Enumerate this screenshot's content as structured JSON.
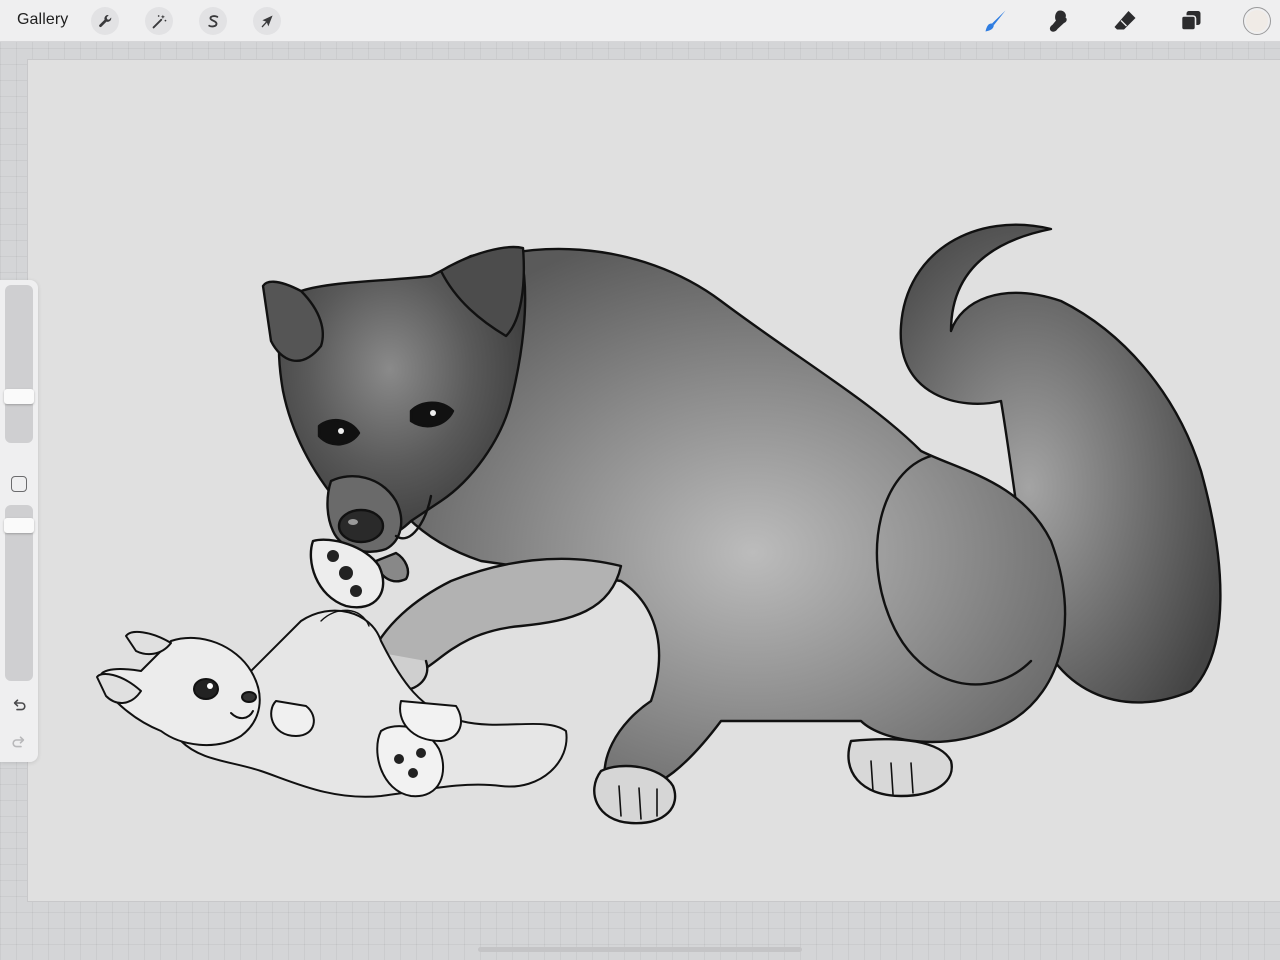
{
  "app": {
    "gallery_label": "Gallery"
  },
  "toolbar": {
    "left_tools": [
      {
        "name": "actions",
        "icon": "wrench-icon"
      },
      {
        "name": "adjustments",
        "icon": "magic-wand-icon"
      },
      {
        "name": "selection",
        "icon": "selection-s-icon"
      },
      {
        "name": "transform",
        "icon": "arrow-cursor-icon"
      }
    ],
    "right_tools": [
      {
        "name": "brush",
        "icon": "brush-icon",
        "active": true
      },
      {
        "name": "smudge",
        "icon": "smudge-icon",
        "active": false
      },
      {
        "name": "eraser",
        "icon": "eraser-icon",
        "active": false
      },
      {
        "name": "layers",
        "icon": "layers-icon",
        "active": false
      }
    ],
    "current_color": "#f0ebe6"
  },
  "sidebar": {
    "brush_size_level": 0.27,
    "opacity_level": 0.92
  },
  "colors": {
    "accent": "#2f7de1",
    "canvas": "#e0e0e0",
    "toolbar": "#efeff0"
  }
}
